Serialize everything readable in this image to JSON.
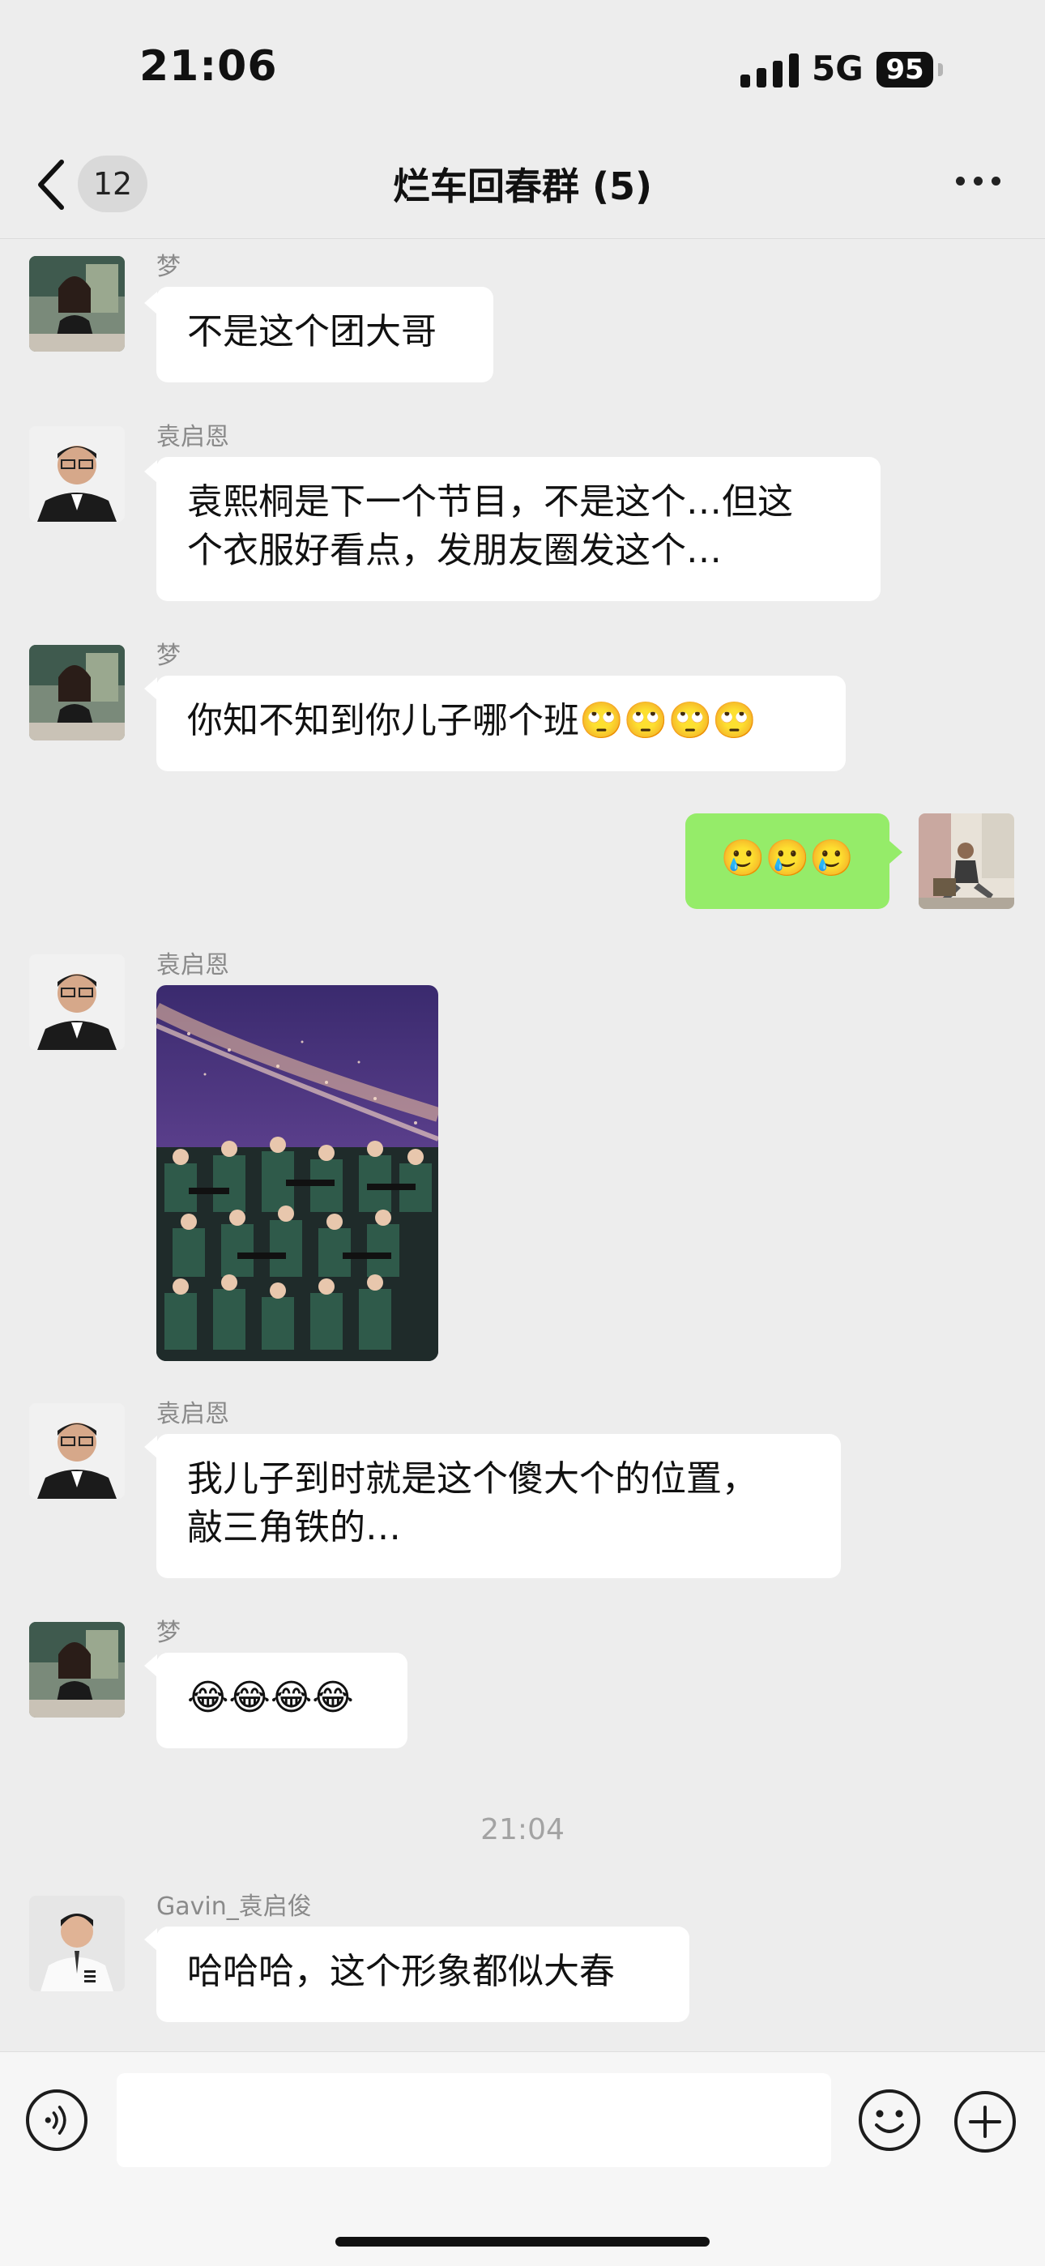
{
  "status": {
    "time": "21:06",
    "network": "5G",
    "battery": "95"
  },
  "nav": {
    "back_count": "12",
    "title": "烂车回春群 (5)"
  },
  "messages": [
    {
      "sender": "梦",
      "text": "不是这个团大哥"
    },
    {
      "sender": "袁启恩",
      "text": "袁熙桐是下一个节目，不是这个…但这\n个衣服好看点，发朋友圈发这个…"
    },
    {
      "sender": "梦",
      "text": "你知不知到你儿子哪个班🙄🙄🙄🙄"
    },
    {
      "sender": "me",
      "text": "🥲🥲🥲"
    },
    {
      "sender": "袁启恩",
      "image": "concert-photo"
    },
    {
      "sender": "袁启恩",
      "text": "我儿子到时就是这个傻大个的位置，\n敲三角铁的…"
    },
    {
      "sender": "梦",
      "text": "😂😂😂😂"
    },
    {
      "timestamp": "21:04"
    },
    {
      "sender": "Gavin_袁启俊",
      "text": "哈哈哈，这个形象都似大春"
    }
  ],
  "icons": {
    "back": "chevron-left-icon",
    "more": "more-dots-icon",
    "voice": "voice-icon",
    "emoji": "emoji-icon",
    "plus": "plus-icon"
  },
  "colors": {
    "background": "#ededed",
    "my_bubble": "#95ec69",
    "their_bubble": "#ffffff"
  }
}
